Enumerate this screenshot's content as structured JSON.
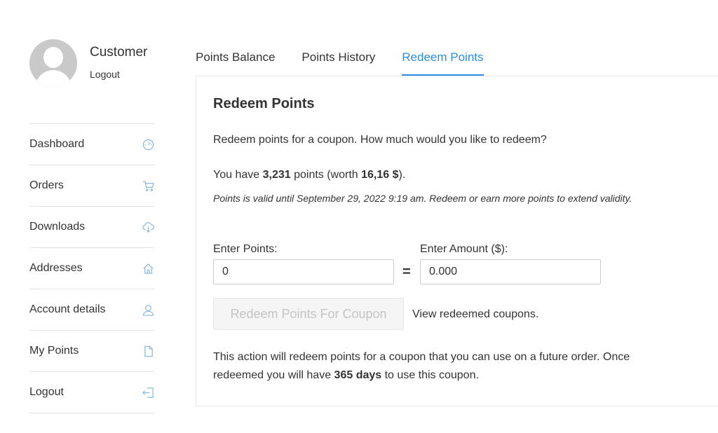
{
  "profile": {
    "name": "Customer",
    "logout_label": "Logout"
  },
  "nav": {
    "items": [
      {
        "label": "Dashboard",
        "icon": "gauge-icon"
      },
      {
        "label": "Orders",
        "icon": "cart-icon"
      },
      {
        "label": "Downloads",
        "icon": "cloud-download-icon"
      },
      {
        "label": "Addresses",
        "icon": "home-icon"
      },
      {
        "label": "Account details",
        "icon": "user-icon"
      },
      {
        "label": "My Points",
        "icon": "document-icon"
      },
      {
        "label": "Logout",
        "icon": "logout-icon"
      }
    ]
  },
  "tabs": [
    {
      "label": "Points Balance",
      "active": false
    },
    {
      "label": "Points History",
      "active": false
    },
    {
      "label": "Redeem Points",
      "active": true
    }
  ],
  "redeem": {
    "title": "Redeem Points",
    "intro": "Redeem points for a coupon. How much would you like to redeem?",
    "balance_prefix": "You have ",
    "points_value": "3,231",
    "balance_middle": " points (worth ",
    "worth_value": "16,16 $",
    "balance_suffix": ").",
    "validity": "Points is valid until September 29, 2022 9:19 am. Redeem or earn more points to extend validity.",
    "points_label": "Enter Points:",
    "points_input_value": "0",
    "equals": "=",
    "amount_label": "Enter Amount ($):",
    "amount_input_value": "0.000",
    "button_label": "Redeem Points For Coupon",
    "view_link": "View redeemed coupons.",
    "note_prefix": "This action will redeem points for a coupon that you can use on a future order. Once redeemed you will have ",
    "note_days": "365 days",
    "note_suffix": " to use this coupon."
  },
  "colors": {
    "accent": "#2c8ee0",
    "icon": "#8cb8e0",
    "text": "#333333",
    "border": "#e3e3e3"
  }
}
